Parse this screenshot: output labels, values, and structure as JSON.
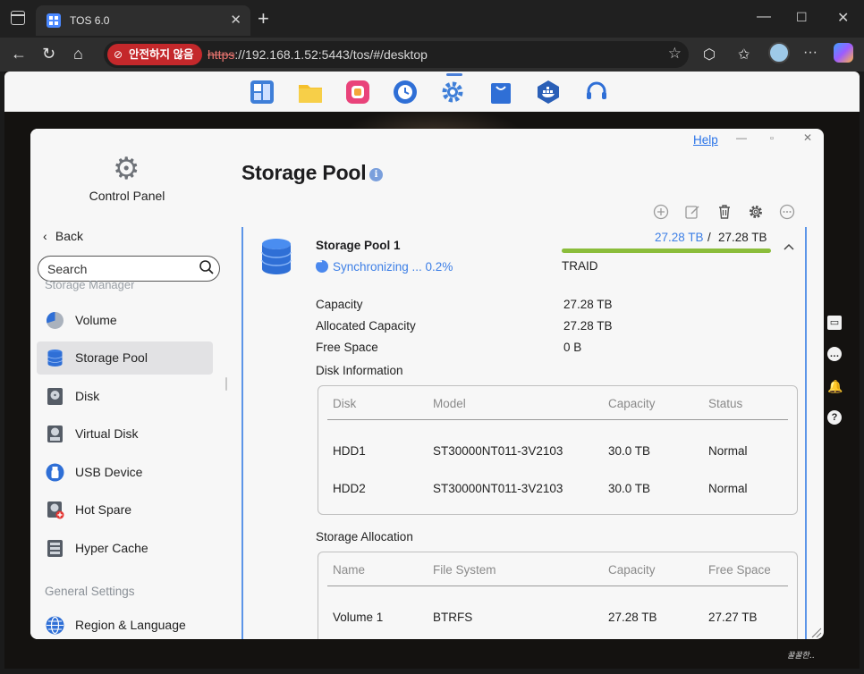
{
  "browser": {
    "tab_title": "TOS 6.0",
    "security_badge": "안전하지 않음",
    "url_scheme": "https",
    "url_rest": "://192.168.1.52:5443/tos/#/desktop"
  },
  "dock": {
    "apps": [
      "storage-manager-app",
      "file-manager-app",
      "app-center-app",
      "backup-app",
      "control-panel-app",
      "shop-app",
      "docker-app",
      "support-app"
    ]
  },
  "control_panel": {
    "title": "Control Panel",
    "help_link": "Help",
    "back_label": "Back",
    "search_label": "Search",
    "section_storage": "Storage Manager",
    "storage_items": [
      {
        "label": "Volume",
        "icon": "volume-icon"
      },
      {
        "label": "Storage Pool",
        "icon": "storage-pool-icon"
      },
      {
        "label": "Disk",
        "icon": "disk-icon"
      },
      {
        "label": "Virtual Disk",
        "icon": "virtual-disk-icon"
      },
      {
        "label": "USB Device",
        "icon": "usb-icon"
      },
      {
        "label": "Hot Spare",
        "icon": "hot-spare-icon"
      },
      {
        "label": "Hyper Cache",
        "icon": "hyper-cache-icon"
      }
    ],
    "section_general": "General Settings",
    "general_items": [
      {
        "label": "Region & Language",
        "icon": "globe-icon"
      }
    ]
  },
  "storage_pool": {
    "page_title": "Storage Pool",
    "pool": {
      "name": "Storage Pool 1",
      "status": "Synchronizing ... 0.2%",
      "used": "27.28 TB",
      "separator": "/",
      "total": "27.28 TB",
      "usage_fraction": 1.0,
      "raid": "TRAID",
      "properties": [
        {
          "label": "Capacity",
          "value": "27.28 TB"
        },
        {
          "label": "Allocated Capacity",
          "value": "27.28 TB"
        },
        {
          "label": "Free Space",
          "value": "0 B"
        }
      ],
      "disk_info_title": "Disk Information",
      "disk_table": {
        "columns": [
          "Disk",
          "Model",
          "Capacity",
          "Status"
        ],
        "rows": [
          [
            "HDD1",
            "ST30000NT011-3V2103",
            "30.0 TB",
            "Normal"
          ],
          [
            "HDD2",
            "ST30000NT011-3V2103",
            "30.0 TB",
            "Normal"
          ]
        ]
      },
      "allocation_title": "Storage Allocation",
      "allocation_table": {
        "columns": [
          "Name",
          "File System",
          "Capacity",
          "Free Space"
        ],
        "rows": [
          [
            "Volume 1",
            "BTRFS",
            "27.28 TB",
            "27.27 TB"
          ]
        ]
      }
    }
  },
  "colors": {
    "accent_blue": "#3d7fe6",
    "usage_green": "#8bbd3b",
    "insecure_red": "#c4282b"
  }
}
